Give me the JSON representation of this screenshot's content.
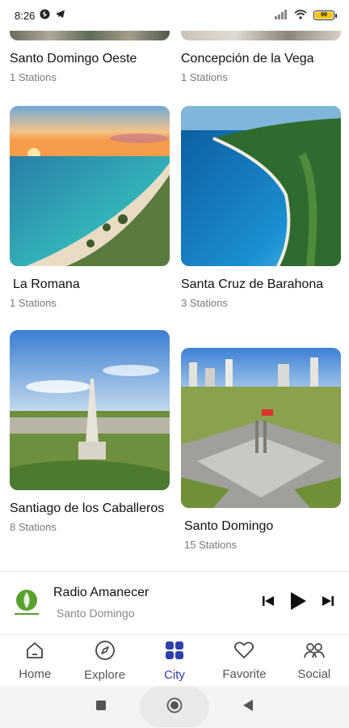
{
  "status": {
    "time": "8:26",
    "battery": "99"
  },
  "cities": [
    {
      "name": "Santo Domingo Oeste",
      "stations": "1 Stations"
    },
    {
      "name": "Concepción de la Vega",
      "stations": "1 Stations"
    },
    {
      "name": "La Romana",
      "stations": "1 Stations"
    },
    {
      "name": "Santa Cruz de Barahona",
      "stations": "3 Stations"
    },
    {
      "name": "Santiago de los Caballeros",
      "stations": "8 Stations"
    },
    {
      "name": "Santo Domingo",
      "stations": "15 Stations"
    }
  ],
  "player": {
    "title": "Radio Amanecer",
    "subtitle": "Santo Domingo"
  },
  "nav": {
    "items": [
      {
        "label": "Home",
        "icon": "home-icon"
      },
      {
        "label": "Explore",
        "icon": "compass-icon"
      },
      {
        "label": "City",
        "icon": "grid-icon"
      },
      {
        "label": "Favorite",
        "icon": "heart-icon"
      },
      {
        "label": "Social",
        "icon": "people-icon"
      }
    ],
    "active": "City"
  },
  "colors": {
    "accent": "#2f3fa8"
  }
}
